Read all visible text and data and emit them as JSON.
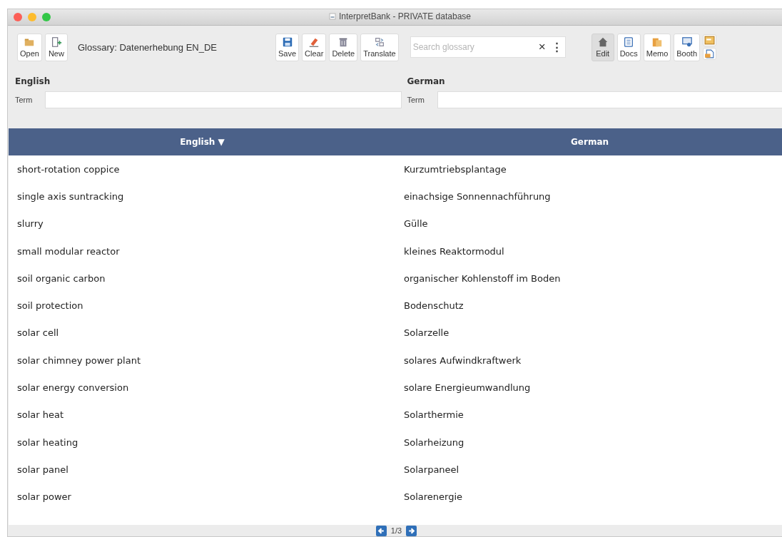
{
  "window": {
    "title": "InterpretBank - PRIVATE database"
  },
  "toolbar": {
    "left_buttons": [
      {
        "label": "Open",
        "kind": "folder"
      },
      {
        "label": "New",
        "kind": "new"
      }
    ],
    "glossary": "Glossary: Datenerhebung EN_DE",
    "mid_buttons": [
      {
        "label": "Save",
        "kind": "save"
      },
      {
        "label": "Clear",
        "kind": "eraser"
      },
      {
        "label": "Delete",
        "kind": "trash"
      },
      {
        "label": "Translate",
        "kind": "translate"
      }
    ],
    "search": {
      "placeholder": "Search glossary",
      "clear": "×",
      "menu": "⋮"
    },
    "right_buttons": [
      {
        "label": "Edit",
        "kind": "home",
        "selected": true
      },
      {
        "label": "Docs",
        "kind": "docs",
        "selected": false
      },
      {
        "label": "Memo",
        "kind": "memo",
        "selected": false
      },
      {
        "label": "Booth",
        "kind": "booth",
        "selected": false
      }
    ]
  },
  "editors": [
    {
      "language": "English",
      "field_label": "Term"
    },
    {
      "language": "German",
      "field_label": "Term"
    }
  ],
  "table": {
    "columns": [
      "English ▼",
      "German"
    ],
    "rows": [
      [
        "short-rotation coppice",
        "Kurzumtriebsplantage"
      ],
      [
        "single axis suntracking",
        "einachsige Sonnennachführung"
      ],
      [
        "slurry",
        "Gülle"
      ],
      [
        "small modular reactor",
        "kleines Reaktormodul"
      ],
      [
        "soil organic carbon",
        "organischer Kohlenstoff im Boden"
      ],
      [
        "soil protection",
        "Bodenschutz"
      ],
      [
        "solar cell",
        "Solarzelle"
      ],
      [
        "solar chimney power plant",
        "solares Aufwindkraftwerk"
      ],
      [
        "solar energy conversion",
        "solare Energieumwandlung"
      ],
      [
        "solar heat",
        "Solarthermie"
      ],
      [
        "solar heating",
        "Solarheizung"
      ],
      [
        "solar panel",
        "Solarpaneel"
      ],
      [
        "solar power",
        "Solarenergie"
      ]
    ]
  },
  "pager": {
    "page": "1/3"
  }
}
